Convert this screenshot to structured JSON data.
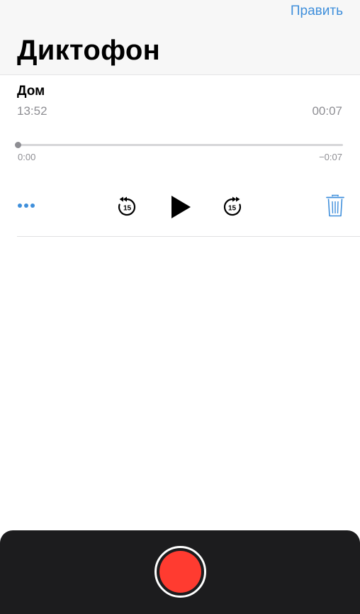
{
  "header": {
    "edit_label": "Править",
    "title": "Диктофон"
  },
  "recording": {
    "name": "Дом",
    "time": "13:52",
    "duration": "00:07",
    "position_start": "0:00",
    "position_end": "−0:07",
    "progress": 0
  },
  "controls": {
    "more_icon": "ellipsis-icon",
    "skip_back_icon": "skip-back-15-icon",
    "skip_back_label": "15",
    "play_icon": "play-icon",
    "skip_forward_icon": "skip-forward-15-icon",
    "skip_forward_label": "15",
    "delete_icon": "trash-icon"
  },
  "colors": {
    "accent": "#3f8fdb",
    "record": "#ff3b30",
    "panel": "#1c1c1e",
    "secondary_text": "#8e8e93"
  }
}
